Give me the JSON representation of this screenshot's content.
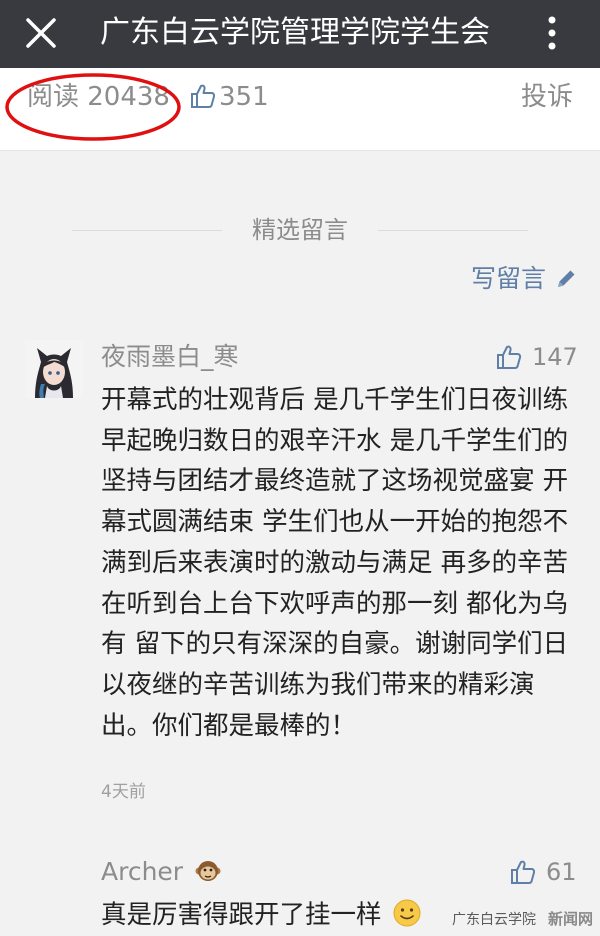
{
  "header": {
    "title": "广东白云学院管理学院学生会"
  },
  "stats": {
    "read_label": "阅读 20438",
    "likes": "351",
    "report_label": "投诉"
  },
  "comments_section": {
    "title": "精选留言",
    "write_label": "写留言"
  },
  "comments": [
    {
      "name": "夜雨墨白_寒",
      "likes": "147",
      "text": "开幕式的壮观背后 是几千学生们日夜训练早起晚归数日的艰辛汗水 是几千学生们的坚持与团结才最终造就了这场视觉盛宴 开幕式圆满结束 学生们也从一开始的抱怨不满到后来表演时的激动与满足 再多的辛苦 在听到台上台下欢呼声的那一刻 都化为乌有 留下的只有深深的自豪。谢谢同学们日以夜继的辛苦训练为我们带来的精彩演出。你们都是最棒的！",
      "time": "4天前"
    },
    {
      "name": "Archer",
      "name_icon": "monkey-emoji",
      "likes": "61",
      "text": "真是厉害得跟开了挂一样",
      "text_icon": "smile-emoji"
    }
  ],
  "watermark": {
    "text": "广东白云学院",
    "seal": "新闻网"
  },
  "colors": {
    "topbar": "#393a3f",
    "link": "#607fa6",
    "annotation": "#e01010",
    "muted": "#8c8c8c"
  }
}
